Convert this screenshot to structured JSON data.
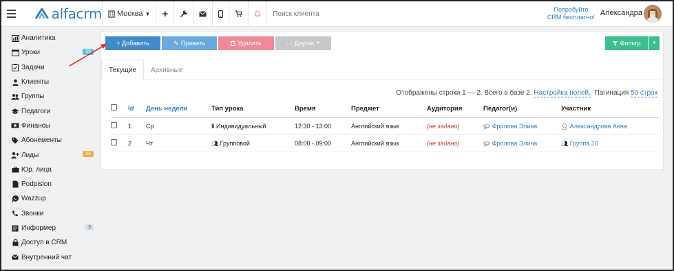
{
  "topbar": {
    "logo_text": "alfacrm",
    "city": "Москва",
    "search_placeholder": "Поиск клиента",
    "try_crm_line1": "Попробуйте",
    "try_crm_line2": "CRM бесплатно!",
    "user_name": "Александра"
  },
  "sidebar": {
    "items": [
      {
        "label": "Аналитика",
        "icon": "chart-icon"
      },
      {
        "label": "Уроки",
        "icon": "calendar-icon",
        "badge": "59",
        "badge_color": "#5bc0de"
      },
      {
        "label": "Задачи",
        "icon": "tasks-icon"
      },
      {
        "label": "Клиенты",
        "icon": "user-icon"
      },
      {
        "label": "Группы",
        "icon": "users-icon"
      },
      {
        "label": "Педагоги",
        "icon": "graduation-cap-icon"
      },
      {
        "label": "Финансы",
        "icon": "money-icon"
      },
      {
        "label": "Абонементы",
        "icon": "tag-icon"
      },
      {
        "label": "Лиды",
        "icon": "user-plus-icon",
        "badge": "24",
        "badge_color": "#f0ad4e"
      },
      {
        "label": "Юр. лица",
        "icon": "briefcase-icon"
      },
      {
        "label": "Podpislon",
        "icon": "file-icon"
      },
      {
        "label": "Wazzup",
        "icon": "whatsapp-icon"
      },
      {
        "label": "Звонки",
        "icon": "phone-icon"
      },
      {
        "label": "Информер",
        "icon": "informer-icon",
        "badge": "3",
        "badge_color": "#d9dde3"
      },
      {
        "label": "Доступ в CRM",
        "icon": "lock-icon"
      },
      {
        "label": "Внутренний чат",
        "icon": "envelope-icon"
      }
    ]
  },
  "toolbar": {
    "add_label": "+ Добавить",
    "edit_label": "Править",
    "delete_label": "Удалить",
    "other_label": "··· Другое",
    "filter_label": "Фильтр"
  },
  "tabs": {
    "current": "Текущие",
    "archive": "Архивные"
  },
  "info": {
    "shown_text": "Отображены строки 1 — 2. Всего в базе 2.",
    "settings_link": "Настройка полей.",
    "pagination_label": "Пагинация",
    "pagination_value": "50 строк"
  },
  "table": {
    "headers": [
      "Id",
      "День недели",
      "Тип урока",
      "Время",
      "Предмет",
      "Аудитория",
      "Педагог(и)",
      "Участник"
    ],
    "rows": [
      {
        "id": "1",
        "day": "Ср",
        "type": "Индивидуальный",
        "time": "12:30 - 13:00",
        "subject": "Английский язык",
        "room": "(не задано)",
        "teacher": "Фролова Элина",
        "member": "Александрова Анна"
      },
      {
        "id": "2",
        "day": "Чт",
        "type": "Групповой",
        "time": "08:00 - 09:00",
        "subject": "Английский язык",
        "room": "(не задано)",
        "teacher": "Фролова Элина",
        "member": "Группа 10"
      }
    ]
  }
}
